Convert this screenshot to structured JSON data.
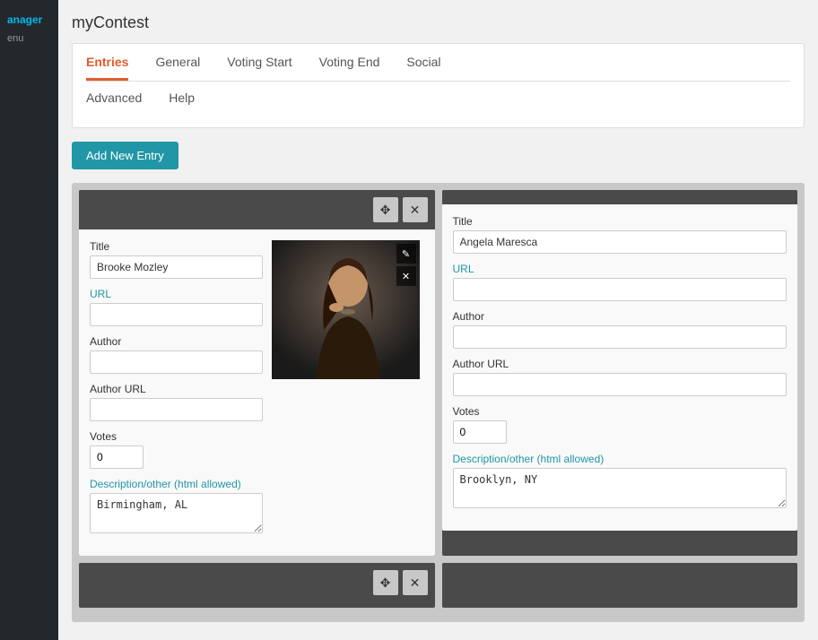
{
  "sidebar": {
    "title": "anager",
    "menu": "enu"
  },
  "header": {
    "contest_title": "myContest"
  },
  "tabs": {
    "row1": [
      {
        "label": "Entries",
        "active": true
      },
      {
        "label": "General",
        "active": false
      },
      {
        "label": "Voting Start",
        "active": false
      },
      {
        "label": "Voting End",
        "active": false
      },
      {
        "label": "Social",
        "active": false
      }
    ],
    "row2": [
      {
        "label": "Advanced",
        "active": false
      },
      {
        "label": "Help",
        "active": false
      }
    ]
  },
  "add_entry_button": "Add New Entry",
  "entries": [
    {
      "id": "entry1",
      "title_label": "Title",
      "title_value": "Brooke Mozley",
      "url_label": "URL",
      "url_value": "",
      "author_label": "Author",
      "author_value": "",
      "author_url_label": "Author URL",
      "author_url_value": "",
      "votes_label": "Votes",
      "votes_value": "0",
      "description_label": "Description/other (html allowed)",
      "description_value": "Birmingham, AL",
      "has_image": true,
      "image_alt": "Entry photo"
    },
    {
      "id": "entry2",
      "title_label": "Title",
      "title_value": "Angela Maresca",
      "url_label": "URL",
      "url_value": "",
      "author_label": "Author",
      "author_value": "",
      "author_url_label": "Author URL",
      "author_url_value": "",
      "votes_label": "Votes",
      "votes_value": "0",
      "description_label": "Description/other (html allowed)",
      "description_value": "Brooklyn, NY",
      "has_image": false,
      "image_alt": ""
    }
  ],
  "icons": {
    "move": "⤢",
    "close": "✕",
    "edit": "✎",
    "remove": "✕"
  }
}
